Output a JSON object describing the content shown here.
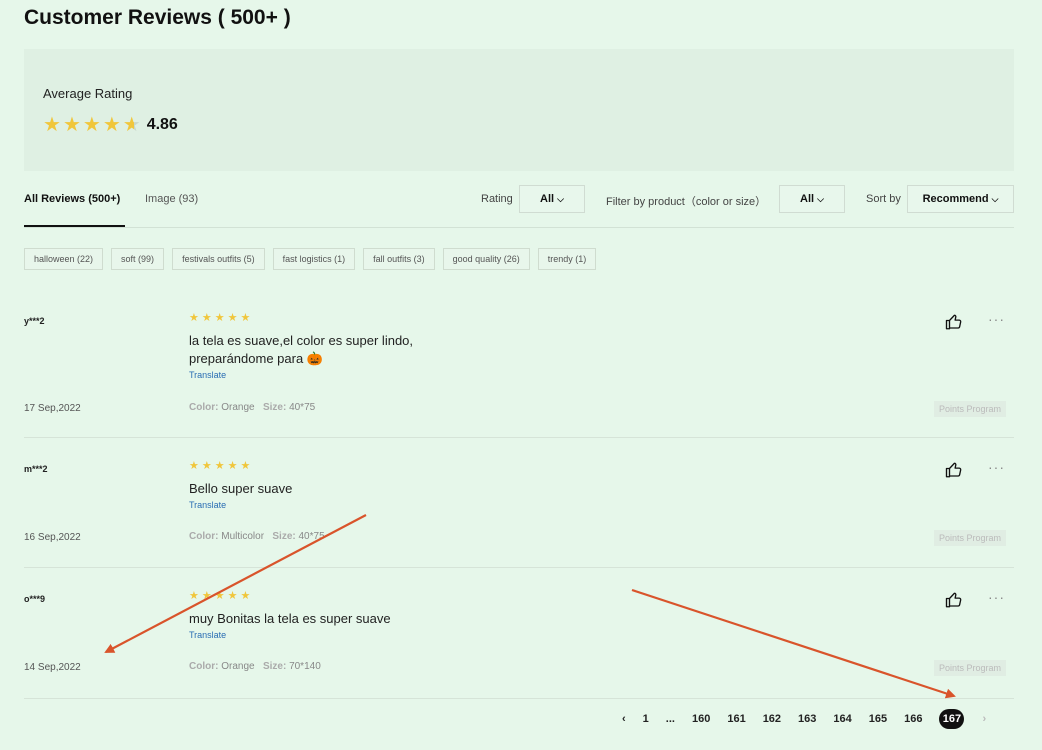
{
  "title": "Customer Reviews ( 500+ )",
  "rating": {
    "label": "Average Rating",
    "value": "4.86",
    "stars": 4.86
  },
  "tabs": [
    {
      "label": "All Reviews (500+)",
      "active": true
    },
    {
      "label": "Image (93)",
      "active": false
    }
  ],
  "filters": {
    "rating_label": "Rating",
    "rating_value": "All",
    "product_label": "Filter by product（color or size）",
    "product_value": "All",
    "sort_label": "Sort by",
    "sort_value": "Recommend"
  },
  "tags": [
    "halloween (22)",
    "soft (99)",
    "festivals outfits (5)",
    "fast logistics (1)",
    "fall outfits (3)",
    "good quality (26)",
    "trendy (1)"
  ],
  "reviews": [
    {
      "user": "y***2",
      "rating": 5,
      "text": "la tela es suave,el color es super lindo, preparándome para 🎃",
      "translate": "Translate",
      "date": "17 Sep,2022",
      "color_label": "Color:",
      "color": "Orange",
      "size_label": "Size:",
      "size": "40*75",
      "points": "Points Program"
    },
    {
      "user": "m***2",
      "rating": 5,
      "text": "Bello super suave",
      "translate": "Translate",
      "date": "16 Sep,2022",
      "color_label": "Color:",
      "color": "Multicolor",
      "size_label": "Size:",
      "size": "40*75",
      "points": "Points Program"
    },
    {
      "user": "o***9",
      "rating": 5,
      "text": "muy Bonitas la tela es super suave",
      "translate": "Translate",
      "date": "14 Sep,2022",
      "color_label": "Color:",
      "color": "Orange",
      "size_label": "Size:",
      "size": "70*140",
      "points": "Points Program"
    }
  ],
  "pagination": {
    "prev": "‹",
    "pages": [
      "1",
      "...",
      "160",
      "161",
      "162",
      "163",
      "164",
      "165",
      "166"
    ],
    "current": "167",
    "next": "›"
  },
  "colors": {
    "star": "#f0c63b",
    "link": "#2a6db3",
    "arrow": "#d9542b",
    "background": "#e6f7ea"
  },
  "icons": [
    "star-icon",
    "thumbs-up-icon",
    "more-icon",
    "chevron-down-icon",
    "chevron-left-icon",
    "chevron-right-icon"
  ]
}
